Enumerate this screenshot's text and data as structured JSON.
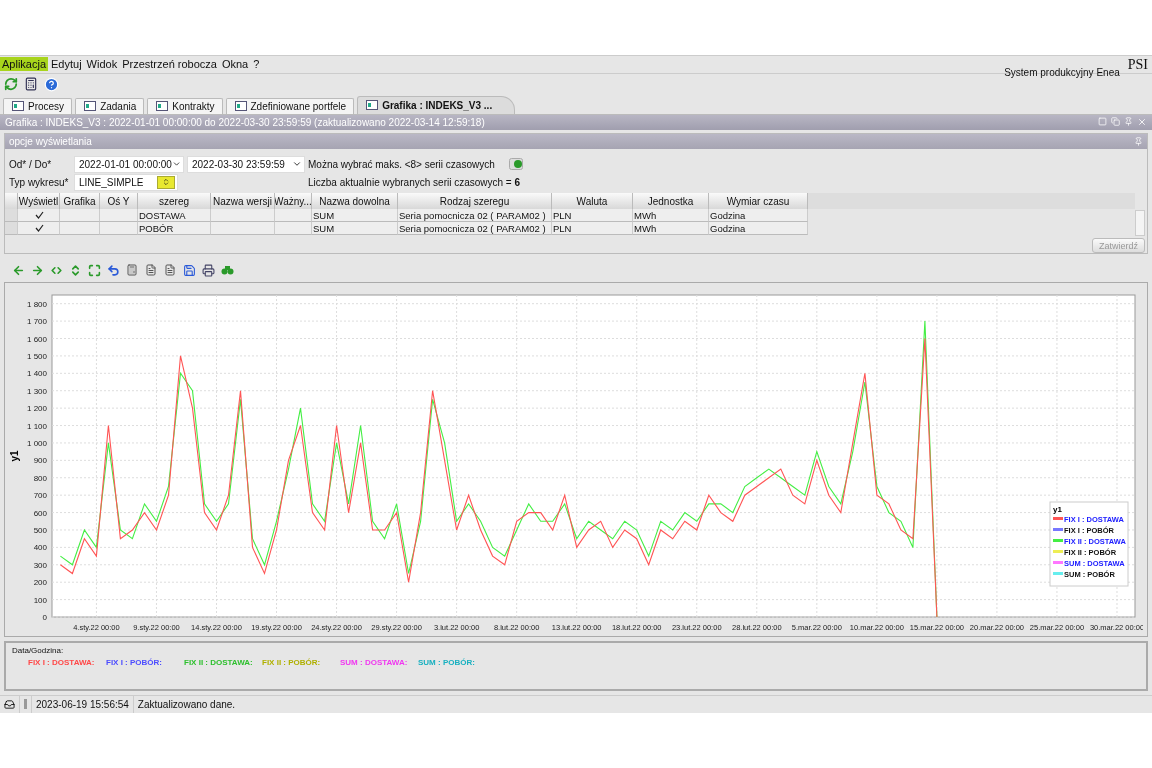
{
  "menu": [
    {
      "label": "Aplikacja",
      "selected": true
    },
    {
      "label": "Edytuj",
      "selected": false
    },
    {
      "label": "Widok",
      "selected": false
    },
    {
      "label": "Przestrzeń robocza",
      "selected": false
    },
    {
      "label": "Okna",
      "selected": false
    },
    {
      "label": "?",
      "selected": false
    }
  ],
  "brand": {
    "logo": "PSI",
    "system": "System produkcyjny Enea"
  },
  "tabs": [
    {
      "label": "Procesy",
      "selected": false
    },
    {
      "label": "Zadania",
      "selected": false
    },
    {
      "label": "Kontrakty",
      "selected": false
    },
    {
      "label": "Zdefiniowane portfele",
      "selected": false
    },
    {
      "label": "Grafika : INDEKS_V3 ...",
      "selected": true
    }
  ],
  "window": {
    "title": "Grafika : INDEKS_V3 : 2022-01-01 00:00:00 do 2022-03-30 23:59:59 (zaktualizowano 2022-03-14 12:59:18)"
  },
  "options": {
    "title": "opcje wyświetlania",
    "range_label": "Od* / Do*",
    "from": "2022-01-01 00:00:00",
    "to": "2022-03-30 23:59:59",
    "type_label": "Typ wykresu*",
    "type": "LINE_SIMPLE",
    "max_info": "Można wybrać maks. <8> serii czasowych",
    "count_info": "Liczba aktualnie wybranych serii czasowych = **6**",
    "confirm": {
      "label": "Zatwierdź",
      "disabled": true
    }
  },
  "table": {
    "columns": [
      "Wyświetl",
      "Grafika",
      "Oś Y",
      "szereg",
      "Nazwa wersji",
      "Ważny...",
      "Nazwa dowolna",
      "Rodzaj szeregu",
      "Waluta",
      "Jednostka",
      "Wymiar czasu"
    ],
    "rows": [
      {
        "shown": true,
        "series": "DOSTAWA",
        "name": "SUM",
        "kind": "Seria pomocnicza 02 ( PARAM02 )",
        "currency": "PLN",
        "unit": "MWh",
        "time": "Godzina"
      },
      {
        "shown": true,
        "series": "POBÓR",
        "name": "SUM",
        "kind": "Seria pomocnicza 02 ( PARAM02 )",
        "currency": "PLN",
        "unit": "MWh",
        "time": "Godzina"
      }
    ]
  },
  "chart": {
    "chart_data": {
      "type": "line",
      "ylabel": "y1",
      "ylim": [
        0,
        1850
      ],
      "grid": true,
      "legend": "lower right",
      "categories": [
        null,
        null,
        null,
        "4.sty.22 00:00",
        null,
        null,
        null,
        null,
        "9.sty.22 00:00",
        null,
        null,
        null,
        null,
        "14.sty.22 00:00",
        null,
        null,
        null,
        null,
        "19.sty.22 00:00",
        null,
        null,
        null,
        null,
        "24.sty.22 00:00",
        null,
        null,
        null,
        null,
        "29.sty.22 00:00",
        null,
        null,
        null,
        null,
        "3.lut.22 00:00",
        null,
        null,
        null,
        null,
        "8.lut.22 00:00",
        null,
        null,
        null,
        null,
        "13.lut.22 00:00",
        null,
        null,
        null,
        null,
        "18.lut.22 00:00",
        null,
        null,
        null,
        null,
        "23.lut.22 00:00",
        null,
        null,
        null,
        null,
        "28.lut.22 00:00",
        null,
        null,
        null,
        null,
        "5.mar.22 00:00",
        null,
        null,
        null,
        null,
        "10.mar.22 00:00",
        null,
        null,
        null,
        null,
        "15.mar.22 00:00",
        null,
        null,
        null,
        null,
        "20.mar.22 00:00",
        null,
        null,
        null,
        null,
        "25.mar.22 00:00",
        null,
        null,
        null,
        null,
        "30.mar.22 00:00",
        null
      ],
      "yticks": [
        {
          "value": 0,
          "label": "0"
        },
        {
          "value": 100,
          "label": "100"
        },
        {
          "value": 200,
          "label": "200"
        },
        {
          "value": 300,
          "label": "300"
        },
        {
          "value": 400,
          "label": "400"
        },
        {
          "value": 500,
          "label": "500"
        },
        {
          "value": 600,
          "label": "600"
        },
        {
          "value": 700,
          "label": "700"
        },
        {
          "value": 800,
          "label": "800"
        },
        {
          "value": 900,
          "label": "900"
        },
        {
          "value": 1000,
          "label": "1 000"
        },
        {
          "value": 1100,
          "label": "1 100"
        },
        {
          "value": 1200,
          "label": "1 200"
        },
        {
          "value": 1300,
          "label": "1 300"
        },
        {
          "value": 1400,
          "label": "1 400"
        },
        {
          "value": 1500,
          "label": "1 500"
        },
        {
          "value": 1600,
          "label": "1 600"
        },
        {
          "value": 1700,
          "label": "1 700"
        },
        {
          "value": 1800,
          "label": "1 800"
        }
      ],
      "series": [
        {
          "name": "FIX I : DOSTAWA",
          "color": "#ff5555",
          "values": [
            300,
            250,
            450,
            350,
            1100,
            450,
            500,
            600,
            500,
            700,
            1500,
            1200,
            600,
            500,
            700,
            1300,
            400,
            250,
            500,
            900,
            1100,
            600,
            500,
            1100,
            600,
            1000,
            500,
            500,
            600,
            200,
            600,
            1300,
            900,
            500,
            700,
            500,
            350,
            300,
            550,
            600,
            600,
            500,
            700,
            400,
            500,
            550,
            400,
            500,
            450,
            300,
            500,
            450,
            550,
            500,
            700,
            600,
            550,
            700,
            750,
            800,
            850,
            700,
            650,
            900,
            700,
            600,
            1000,
            1400,
            700,
            650,
            500,
            450,
            1600,
            0,
            null,
            null,
            null,
            null,
            null,
            null,
            null,
            null,
            null,
            null,
            null,
            null,
            null,
            null,
            null,
            null
          ]
        },
        {
          "name": "FIX I : POBÓR",
          "color": "#7777ff",
          "values": [
            null,
            null,
            null,
            null,
            null,
            null,
            null,
            null,
            null,
            null,
            null,
            null,
            null,
            null,
            null,
            null,
            null,
            null,
            null,
            null,
            null,
            null,
            null,
            null,
            null,
            null,
            null,
            null,
            null,
            null,
            null,
            null,
            null,
            null,
            null,
            null,
            null,
            null,
            null,
            null,
            null,
            null,
            null,
            null,
            null,
            null,
            null,
            null,
            null,
            null,
            null,
            null,
            null,
            null,
            null,
            null,
            null,
            null,
            null,
            null,
            null,
            null,
            null,
            null,
            null,
            null,
            null,
            null,
            null,
            null,
            null,
            null,
            null,
            null,
            null,
            null,
            null,
            null,
            null,
            null,
            null,
            null,
            null,
            null,
            null,
            null,
            null,
            null,
            null,
            null
          ]
        },
        {
          "name": "FIX II : DOSTAWA",
          "color": "#44ee44",
          "values": [
            350,
            300,
            500,
            400,
            1000,
            500,
            450,
            650,
            550,
            750,
            1400,
            1300,
            650,
            550,
            650,
            1250,
            450,
            300,
            550,
            850,
            1200,
            650,
            550,
            1000,
            650,
            1100,
            550,
            450,
            650,
            250,
            550,
            1250,
            1000,
            550,
            650,
            550,
            400,
            350,
            500,
            650,
            550,
            550,
            650,
            450,
            550,
            500,
            450,
            550,
            500,
            350,
            550,
            500,
            600,
            550,
            650,
            650,
            600,
            750,
            800,
            850,
            800,
            750,
            700,
            950,
            750,
            650,
            950,
            1350,
            750,
            600,
            550,
            400,
            1700,
            0,
            null,
            null,
            null,
            null,
            null,
            null,
            null,
            null,
            null,
            null,
            null,
            null,
            null,
            null,
            null,
            null
          ]
        },
        {
          "name": "FIX II : POBÓR",
          "color": "#eeee55",
          "values": [
            null,
            null,
            null,
            null,
            null,
            null,
            null,
            null,
            null,
            null,
            null,
            null,
            null,
            null,
            null,
            null,
            null,
            null,
            null,
            null,
            null,
            null,
            null,
            null,
            null,
            null,
            null,
            null,
            null,
            null,
            null,
            null,
            null,
            null,
            null,
            null,
            null,
            null,
            null,
            null,
            null,
            null,
            null,
            null,
            null,
            null,
            null,
            null,
            null,
            null,
            null,
            null,
            null,
            null,
            null,
            null,
            null,
            null,
            null,
            null,
            null,
            null,
            null,
            null,
            null,
            null,
            null,
            null,
            null,
            null,
            null,
            null,
            null,
            null,
            null,
            null,
            null,
            null,
            null,
            null,
            null,
            null,
            null,
            null,
            null,
            null,
            null,
            null,
            null,
            null
          ]
        },
        {
          "name": "SUM : DOSTAWA",
          "color": "#ff77ff",
          "values": [
            null,
            null,
            null,
            null,
            null,
            null,
            null,
            null,
            null,
            null,
            null,
            null,
            null,
            null,
            null,
            null,
            null,
            null,
            null,
            null,
            null,
            null,
            null,
            null,
            null,
            null,
            null,
            null,
            null,
            null,
            null,
            null,
            null,
            null,
            null,
            null,
            null,
            null,
            null,
            null,
            null,
            null,
            null,
            null,
            null,
            null,
            null,
            null,
            null,
            null,
            null,
            null,
            null,
            null,
            null,
            null,
            null,
            null,
            null,
            null,
            null,
            null,
            null,
            null,
            null,
            null,
            null,
            null,
            null,
            null,
            null,
            null,
            null,
            null,
            null,
            null,
            null,
            null,
            null,
            null,
            null,
            null,
            null,
            null,
            null,
            null,
            null,
            null,
            null,
            null
          ]
        },
        {
          "name": "SUM : POBÓR",
          "color": "#66eeee",
          "values": [
            null,
            null,
            null,
            null,
            null,
            null,
            null,
            null,
            null,
            null,
            null,
            null,
            null,
            null,
            null,
            null,
            null,
            null,
            null,
            null,
            null,
            null,
            null,
            null,
            null,
            null,
            null,
            null,
            null,
            null,
            null,
            null,
            null,
            null,
            null,
            null,
            null,
            null,
            null,
            null,
            null,
            null,
            null,
            null,
            null,
            null,
            null,
            null,
            null,
            null,
            null,
            null,
            null,
            null,
            null,
            null,
            null,
            null,
            null,
            null,
            null,
            null,
            null,
            null,
            null,
            null,
            null,
            null,
            null,
            null,
            null,
            null,
            null,
            null,
            null,
            null,
            null,
            null,
            null,
            null,
            null,
            null,
            null,
            null,
            null,
            null,
            null,
            null,
            null,
            null
          ]
        }
      ]
    },
    "legend": {
      "items": [
        {
          "emphasis": true
        },
        {
          "emphasis": false
        },
        {
          "emphasis": true
        },
        {
          "emphasis": false
        },
        {
          "emphasis": true
        },
        {
          "emphasis": false
        }
      ]
    }
  },
  "readout": {
    "title": "Data/Godzina:",
    "items": [
      {
        "label": "FIX I : DOSTAWA:",
        "color": "#ff4848"
      },
      {
        "label": "FIX I : POBÓR:",
        "color": "#4c4cff"
      },
      {
        "label": "FIX II : DOSTAWA:",
        "color": "#2ec02e"
      },
      {
        "label": "FIX II : POBÓR:",
        "color": "#b0b000"
      },
      {
        "label": "SUM : DOSTAWA:",
        "color": "#f038f0"
      },
      {
        "label": "SUM : POBÓR:",
        "color": "#18b0c0"
      }
    ]
  },
  "status_bar": {
    "time": "2023-06-19 15:56:54",
    "message": "Zaktualizowano dane."
  }
}
